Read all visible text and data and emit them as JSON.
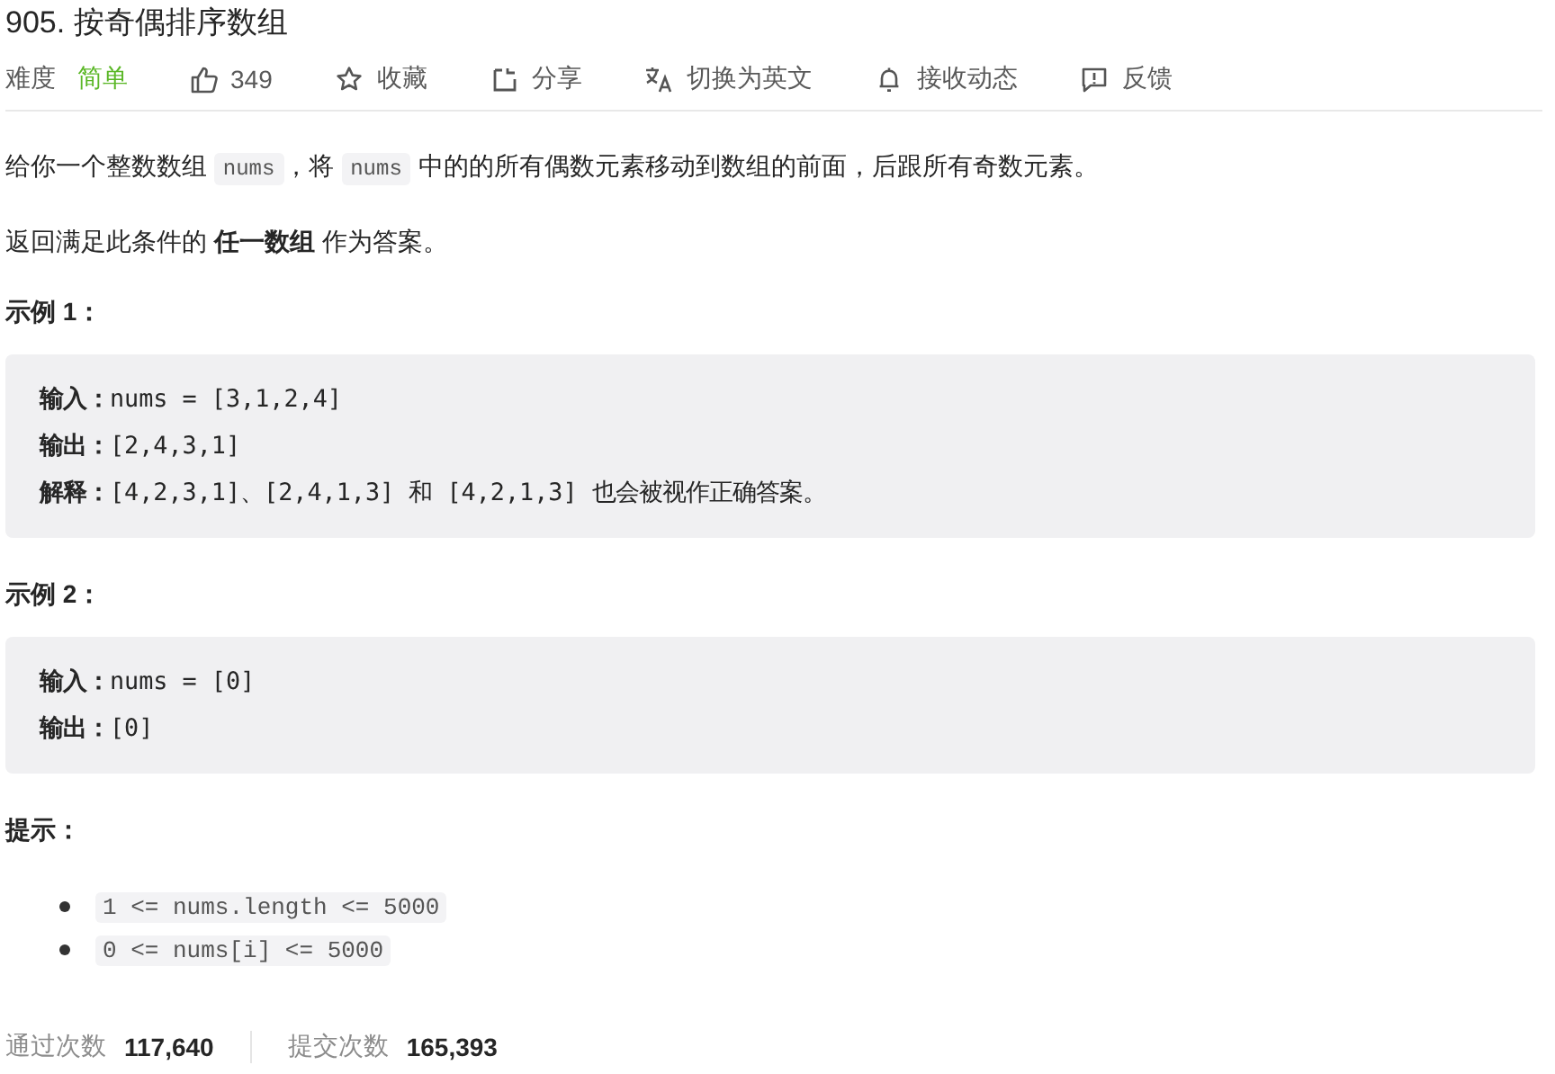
{
  "title": "905. 按奇偶排序数组",
  "toolbar": {
    "difficulty_label": "难度",
    "difficulty": "简单",
    "actions": [
      {
        "kind": "like",
        "label": "349"
      },
      {
        "kind": "star",
        "label": "收藏"
      },
      {
        "kind": "share",
        "label": "分享"
      },
      {
        "kind": "translate",
        "label": "切换为英文"
      },
      {
        "kind": "bell",
        "label": "接收动态"
      },
      {
        "kind": "feedback",
        "label": "反馈"
      }
    ]
  },
  "description": [
    [
      {
        "kind": "text",
        "text": "给你一个整数数组 "
      },
      {
        "kind": "code",
        "text": "nums"
      },
      {
        "kind": "text",
        "text": "，将 "
      },
      {
        "kind": "code",
        "text": "nums"
      },
      {
        "kind": "text",
        "text": " 中的的所有偶数元素移动到数组的前面，后跟所有奇数元素。"
      }
    ],
    [
      {
        "kind": "text",
        "text": "返回满足此条件的 **任一数组** 作为答案。"
      }
    ]
  ],
  "examples": [
    {
      "heading": "示例 1：",
      "lines": [
        "**输入：**nums = [3,1,2,4]",
        "**输出：**[2,4,3,1]",
        "**解释：**[4,2,3,1]、[2,4,1,3] 和 [4,2,1,3] 也会被视作正确答案。"
      ]
    },
    {
      "heading": "示例 2：",
      "lines": [
        "**输入：**nums = [0]",
        "**输出：**[0]"
      ]
    }
  ],
  "hints": {
    "heading": "提示：",
    "items": [
      "1 <= nums.length <= 5000",
      "0 <= nums[i] <= 5000"
    ]
  },
  "stats": [
    {
      "label": "通过次数",
      "value": "117,640"
    },
    {
      "label": "提交次数",
      "value": "165,393"
    }
  ]
}
